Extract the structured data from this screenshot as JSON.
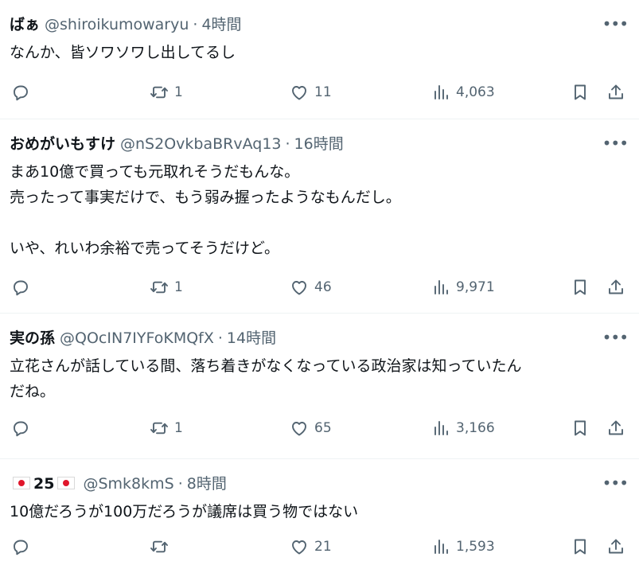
{
  "tweets": [
    {
      "name": "ばぁ",
      "handle": "@shiroikumowaryu",
      "time": "4時間",
      "text": "なんか、皆ソワソワし出してるし",
      "replies": "",
      "retweets": "1",
      "likes": "11",
      "views": "4,063"
    },
    {
      "name": "おめがいもすけ",
      "handle": "@nS2OvkbaBRvAq13",
      "time": "16時間",
      "text": "まあ10億で買っても元取れそうだもんな。\n売ったって事実だけで、もう弱み握ったようなもんだし。\n\nいや、れいわ余裕で売ってそうだけど。",
      "replies": "",
      "retweets": "1",
      "likes": "46",
      "views": "9,971"
    },
    {
      "name": "実の孫",
      "handle": "@QOcIN7IYFoKMQfX",
      "time": "14時間",
      "text": "立花さんが話している間、落ち着きがなくなっている政治家は知っていたん\nだね。",
      "replies": "",
      "retweets": "1",
      "likes": "65",
      "views": "3,166"
    },
    {
      "name": "25",
      "handle": "@Smk8kmS",
      "time": "8時間",
      "text": "10億だろうが100万だろうが議席は買う物ではない",
      "replies": "",
      "retweets": "",
      "likes": "21",
      "views": "1,593"
    }
  ],
  "ui": {
    "dot": "·",
    "more": "•••"
  },
  "icons": [
    "reply-icon",
    "retweet-icon",
    "like-icon",
    "views-icon",
    "bookmark-icon",
    "share-icon",
    "more-icon",
    "japan-flag-icon"
  ],
  "colors": {
    "text": "#0f1419",
    "secondary": "#536471",
    "divider": "#eff3f4",
    "flag_red": "#e0162b"
  }
}
